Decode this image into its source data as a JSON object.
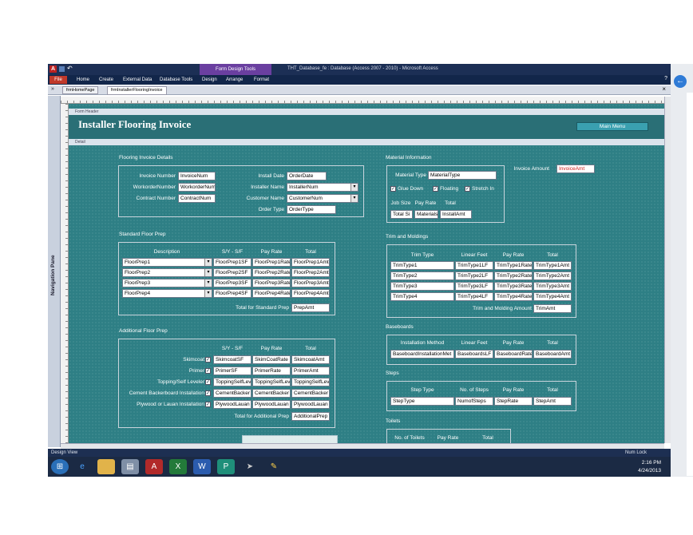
{
  "window": {
    "title": "THT_Database_fe : Database (Access 2007 - 2010) - Microsoft Access",
    "tools_tab": "Form Design Tools"
  },
  "ribbon": {
    "tabs": [
      "File",
      "Home",
      "Create",
      "External Data",
      "Database Tools",
      "Design",
      "Arrange",
      "Format"
    ]
  },
  "doc_tabs": [
    "frmHomePage",
    "frmInstallerFlooringInvoice"
  ],
  "nav_pane": {
    "label": "Navigation Pane"
  },
  "sections": {
    "form_header": "Form Header",
    "detail": "Detail"
  },
  "form": {
    "title": "Installer Flooring Invoice",
    "main_menu_button": "Main Menu",
    "details": {
      "heading": "Flooring Invoice Details",
      "invoice_number": {
        "label": "Invoice Number",
        "value": "InvoiceNum"
      },
      "workorder_number": {
        "label": "WorkorderNumber",
        "value": "WorkorderNum"
      },
      "contract_number": {
        "label": "Contract Number",
        "value": "ContractNum"
      },
      "install_date": {
        "label": "Install Date",
        "value": "OrderDate"
      },
      "installer_name": {
        "label": "Installer Name",
        "value": "InstallerNum"
      },
      "customer_name": {
        "label": "Customer Name",
        "value": "CustomerNum"
      },
      "order_type": {
        "label": "Order Type",
        "value": "OrderType"
      }
    },
    "standard_prep": {
      "heading": "Standard Floor Prep",
      "headers": {
        "description": "Description",
        "sf": "S/Y - S/F",
        "rate": "Pay Rate",
        "total": "Total"
      },
      "rows": [
        {
          "desc": "FloorPrep1",
          "sf": "FloorPrep1SF",
          "rate": "FloorPrep1Rate",
          "total": "FloorPrep1Amt"
        },
        {
          "desc": "FloorPrep2",
          "sf": "FloorPrep2SF",
          "rate": "FloorPrep2Rate",
          "total": "FloorPrep2Amt"
        },
        {
          "desc": "FloorPrep3",
          "sf": "FloorPrep3SF",
          "rate": "FloorPrep3Rate",
          "total": "FloorPrep3Amt"
        },
        {
          "desc": "FloorPrep4",
          "sf": "FloorPrep4SF",
          "rate": "FloorPrep4Rate",
          "total": "FloorPrep4Amt"
        }
      ],
      "total_label": "Total for Standard Prep",
      "total_value": "PrepAmt"
    },
    "additional_prep": {
      "heading": "Additional Floor Prep",
      "headers": {
        "sf": "S/Y - S/F",
        "rate": "Pay Rate",
        "total": "Total"
      },
      "rows": [
        {
          "label": "Skimcoat",
          "sf": "SkimcoatSF",
          "rate": "SkimCoatRate",
          "total": "SkimcoatAmt"
        },
        {
          "label": "Primer",
          "sf": "PrimerSF",
          "rate": "PrimerRate",
          "total": "PrimerAmt"
        },
        {
          "label": "Topping/Self Leveler",
          "sf": "ToppingSelfLev",
          "rate": "ToppingSelfLev",
          "total": "ToppingSelfLev"
        },
        {
          "label": "Cement Backerboard Installation",
          "sf": "CementBacker",
          "rate": "CementBacker",
          "total": "CementBacker"
        },
        {
          "label": "Plywood or Lauan Installation",
          "sf": "PlywoodLauan",
          "rate": "PlywoodLauan",
          "total": "PlywoodLauan"
        }
      ],
      "total_label": "Total for Additional Prep",
      "total_value": "AdditionalPrep"
    },
    "material": {
      "heading": "Material Information",
      "type_label": "Material Type",
      "type_value": "MaterialType",
      "invoice_amount_label": "Invoice Amount",
      "invoice_amount_value": "InvoiceAmt",
      "checks": [
        "Glue Down",
        "Floating",
        "Stretch In"
      ],
      "headers": {
        "job_size": "Job Size",
        "pay_rate": "Pay Rate",
        "total": "Total"
      },
      "values": {
        "job_size": "Total Si",
        "pay_rate": "Materials",
        "total": "InstallAmt"
      }
    },
    "trim": {
      "heading": "Trim and Moldings",
      "headers": {
        "type": "Trim Type",
        "feet": "Linear Feet",
        "rate": "Pay Rate",
        "total": "Total"
      },
      "rows": [
        {
          "type": "TrimType1",
          "feet": "TrimType1LF",
          "rate": "TrimType1Rate",
          "total": "TrimType1Amt"
        },
        {
          "type": "TrimType2",
          "feet": "TrimType2LF",
          "rate": "TrimType2Rate",
          "total": "TrimType2Amt"
        },
        {
          "type": "TrimType3",
          "feet": "TrimType3LF",
          "rate": "TrimType3Rate",
          "total": "TrimType3Amt"
        },
        {
          "type": "TrimType4",
          "feet": "TrimType4LF",
          "rate": "TrimType4Rate",
          "total": "TrimType4Amt"
        }
      ],
      "total_label": "Trim and Molding Amount",
      "total_value": "TrimAmt"
    },
    "baseboards": {
      "heading": "Baseboards",
      "headers": {
        "method": "Installation Method",
        "feet": "Linear Feet",
        "rate": "Pay Rate",
        "total": "Total"
      },
      "values": {
        "method": "BaseboardInstallationMet",
        "feet": "BaseboardsLF",
        "rate": "BaseboardRate",
        "total": "BaseboardAmt"
      }
    },
    "steps": {
      "heading": "Steps",
      "headers": {
        "type": "Step Type",
        "count": "No. of Steps",
        "rate": "Pay Rate",
        "total": "Total"
      },
      "values": {
        "type": "StepType",
        "count": "NumofSteps",
        "rate": "StepRate",
        "total": "StepAmt"
      }
    },
    "toilets": {
      "heading": "Toilets",
      "headers": {
        "count": "No. of Toilets",
        "rate": "Pay Rate",
        "total": "Total"
      }
    }
  },
  "status": {
    "left": "Design View",
    "right": "Num Lock"
  },
  "clock": {
    "time": "2:16 PM",
    "date": "4/24/2013"
  },
  "colors": {
    "canvas": "#2e7f85",
    "title_bar": "#1c2f55",
    "file_tab": "#c0392b",
    "design_tools": "#6a3fa0"
  }
}
